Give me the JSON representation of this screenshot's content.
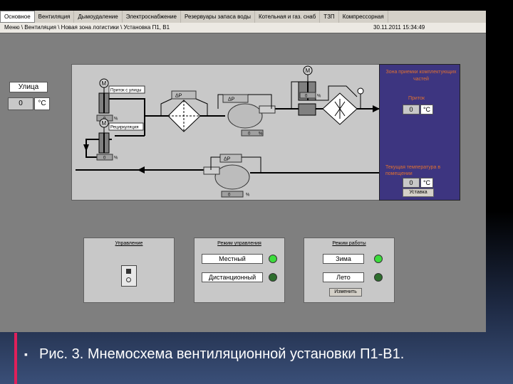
{
  "menu": [
    "Основное",
    "Вентиляция",
    "Дымоудаление",
    "Электроснабжение",
    "Резервуары запаса воды",
    "Котельная и газ. снаб",
    "ТЗП",
    "Компрессорная"
  ],
  "breadcrumb": "Меню \\ Вентиляция \\ Новая зона логистики \\ Установка П1, В1",
  "datetime": "30.11.2011 15:34:49",
  "outdoor": {
    "title": "Улица",
    "value": "0",
    "unit": "°C"
  },
  "diagram": {
    "valve1_label": "Приток с улицы",
    "valve2_label": "Рециркуляция",
    "valve_pos": "0",
    "pct": "%",
    "dp": "ΔP",
    "motor": "M",
    "fan_val": "0",
    "sensor_t": "t"
  },
  "zone": {
    "title": "Зона приемки комплектующих частей",
    "supply_label": "Приток",
    "supply_value": "0",
    "unit": "°C",
    "room_label": "Текущая температура в помещении",
    "room_value": "0",
    "setpoint_button": "Уставка"
  },
  "control_panel": {
    "title": "Управление"
  },
  "mode_panel": {
    "title": "Режим управления",
    "local": "Местный",
    "remote": "Дистанционный"
  },
  "work_panel": {
    "title": "Режим работы",
    "winter": "Зима",
    "summer": "Лето",
    "change_button": "Изменить"
  },
  "caption": "Рис. 3. Мнемосхема вентиляционной установки П1-В1.",
  "colors": {
    "zone_bg": "#3d3580",
    "screen_bg": "#7f7f7f",
    "led_green": "#3cdc3c",
    "led_dark": "#2d6e2d"
  }
}
